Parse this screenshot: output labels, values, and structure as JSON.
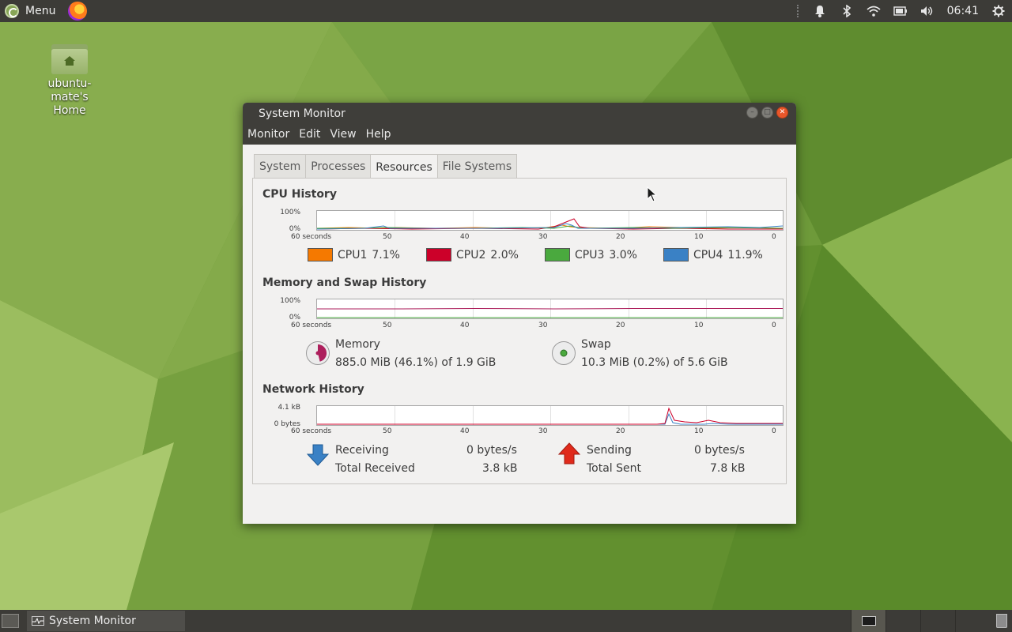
{
  "top_panel": {
    "menu_label": "Menu",
    "clock": "06:41",
    "icons": [
      "notification-icon",
      "bluetooth-icon",
      "wifi-icon",
      "battery-icon",
      "volume-icon",
      "power-icon"
    ]
  },
  "desktop": {
    "home_icon_label_line1": "ubuntu-mate's",
    "home_icon_label_line2": "Home"
  },
  "window": {
    "title": "System Monitor",
    "menu": [
      "Monitor",
      "Edit",
      "View",
      "Help"
    ],
    "tabs": [
      "System",
      "Processes",
      "Resources",
      "File Systems"
    ],
    "active_tab": "Resources"
  },
  "cpu": {
    "title": "CPU History",
    "y_top": "100%",
    "y_bottom": "0%",
    "x_labels": [
      "60 seconds",
      "50",
      "40",
      "30",
      "20",
      "10",
      "0"
    ],
    "legend": [
      {
        "name": "CPU1",
        "value": "7.1%",
        "color": "#f57900"
      },
      {
        "name": "CPU2",
        "value": "2.0%",
        "color": "#cc0029"
      },
      {
        "name": "CPU3",
        "value": "3.0%",
        "color": "#4aa93e"
      },
      {
        "name": "CPU4",
        "value": "11.9%",
        "color": "#3a81c5"
      }
    ]
  },
  "memory": {
    "title": "Memory and Swap History",
    "y_top": "100%",
    "y_bottom": "0%",
    "x_labels": [
      "60 seconds",
      "50",
      "40",
      "30",
      "20",
      "10",
      "0"
    ],
    "memory_label": "Memory",
    "memory_value": "885.0 MiB (46.1%) of 1.9 GiB",
    "memory_fraction": 0.461,
    "memory_color": "#ad1f5c",
    "swap_label": "Swap",
    "swap_value": "10.3 MiB (0.2%) of 5.6 GiB",
    "swap_fraction": 0.002,
    "swap_color": "#4aa93e"
  },
  "network": {
    "title": "Network History",
    "y_top": "4.1 kB",
    "y_bottom": "0 bytes",
    "x_labels": [
      "60 seconds",
      "50",
      "40",
      "30",
      "20",
      "10",
      "0"
    ],
    "receiving_label": "Receiving",
    "receiving_value": "0 bytes/s",
    "total_received_label": "Total Received",
    "total_received_value": "3.8 kB",
    "sending_label": "Sending",
    "sending_value": "0 bytes/s",
    "total_sent_label": "Total Sent",
    "total_sent_value": "7.8 kB"
  },
  "taskbar": {
    "task_label": "System Monitor"
  }
}
